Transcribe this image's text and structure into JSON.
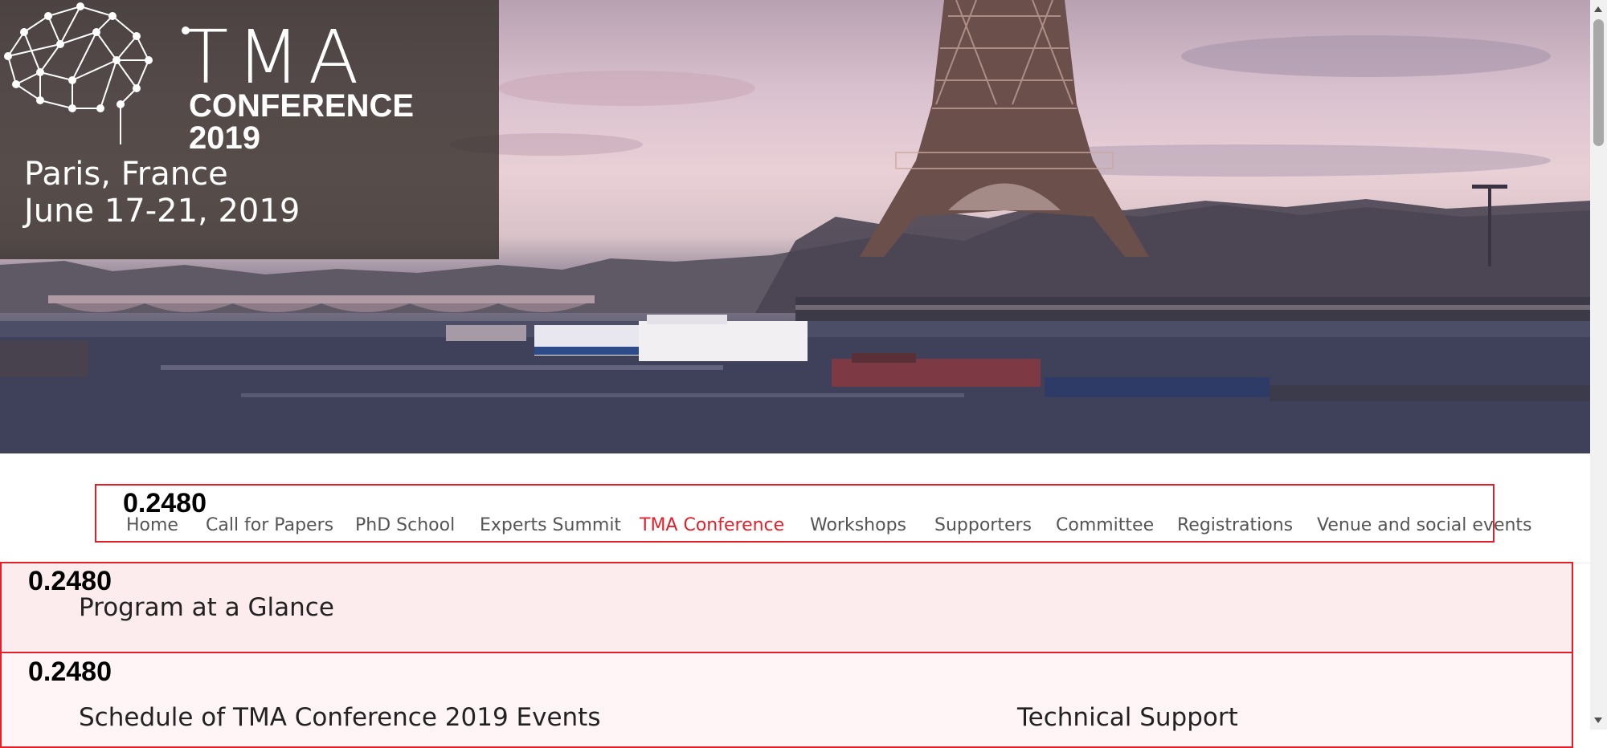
{
  "brand": {
    "logo_title": "TMA",
    "logo_conference": "CONFERENCE",
    "logo_year": "2019",
    "location": "Paris, France",
    "dates": "June 17-21, 2019"
  },
  "nav": {
    "badge": "0.2480",
    "items": [
      {
        "label": "Home"
      },
      {
        "label": "Call for Papers"
      },
      {
        "label": "PhD School"
      },
      {
        "label": "Experts Summit"
      },
      {
        "label": "TMA Conference"
      },
      {
        "label": "Workshops"
      },
      {
        "label": "Supporters"
      },
      {
        "label": "Committee"
      },
      {
        "label": "Registrations"
      },
      {
        "label": "Venue and social events"
      }
    ],
    "active_item": "TMA Conference"
  },
  "sections": [
    {
      "badge": "0.2480",
      "title": "Program at a Glance"
    },
    {
      "badge": "0.2480",
      "title": "Schedule of TMA Conference 2019 Events",
      "side_title": "Technical Support"
    }
  ],
  "colors": {
    "accent": "#e3202a",
    "menu_text": "#555555",
    "section_bg": "#fdecee"
  },
  "icons": {
    "logo": "brain-network-icon"
  }
}
